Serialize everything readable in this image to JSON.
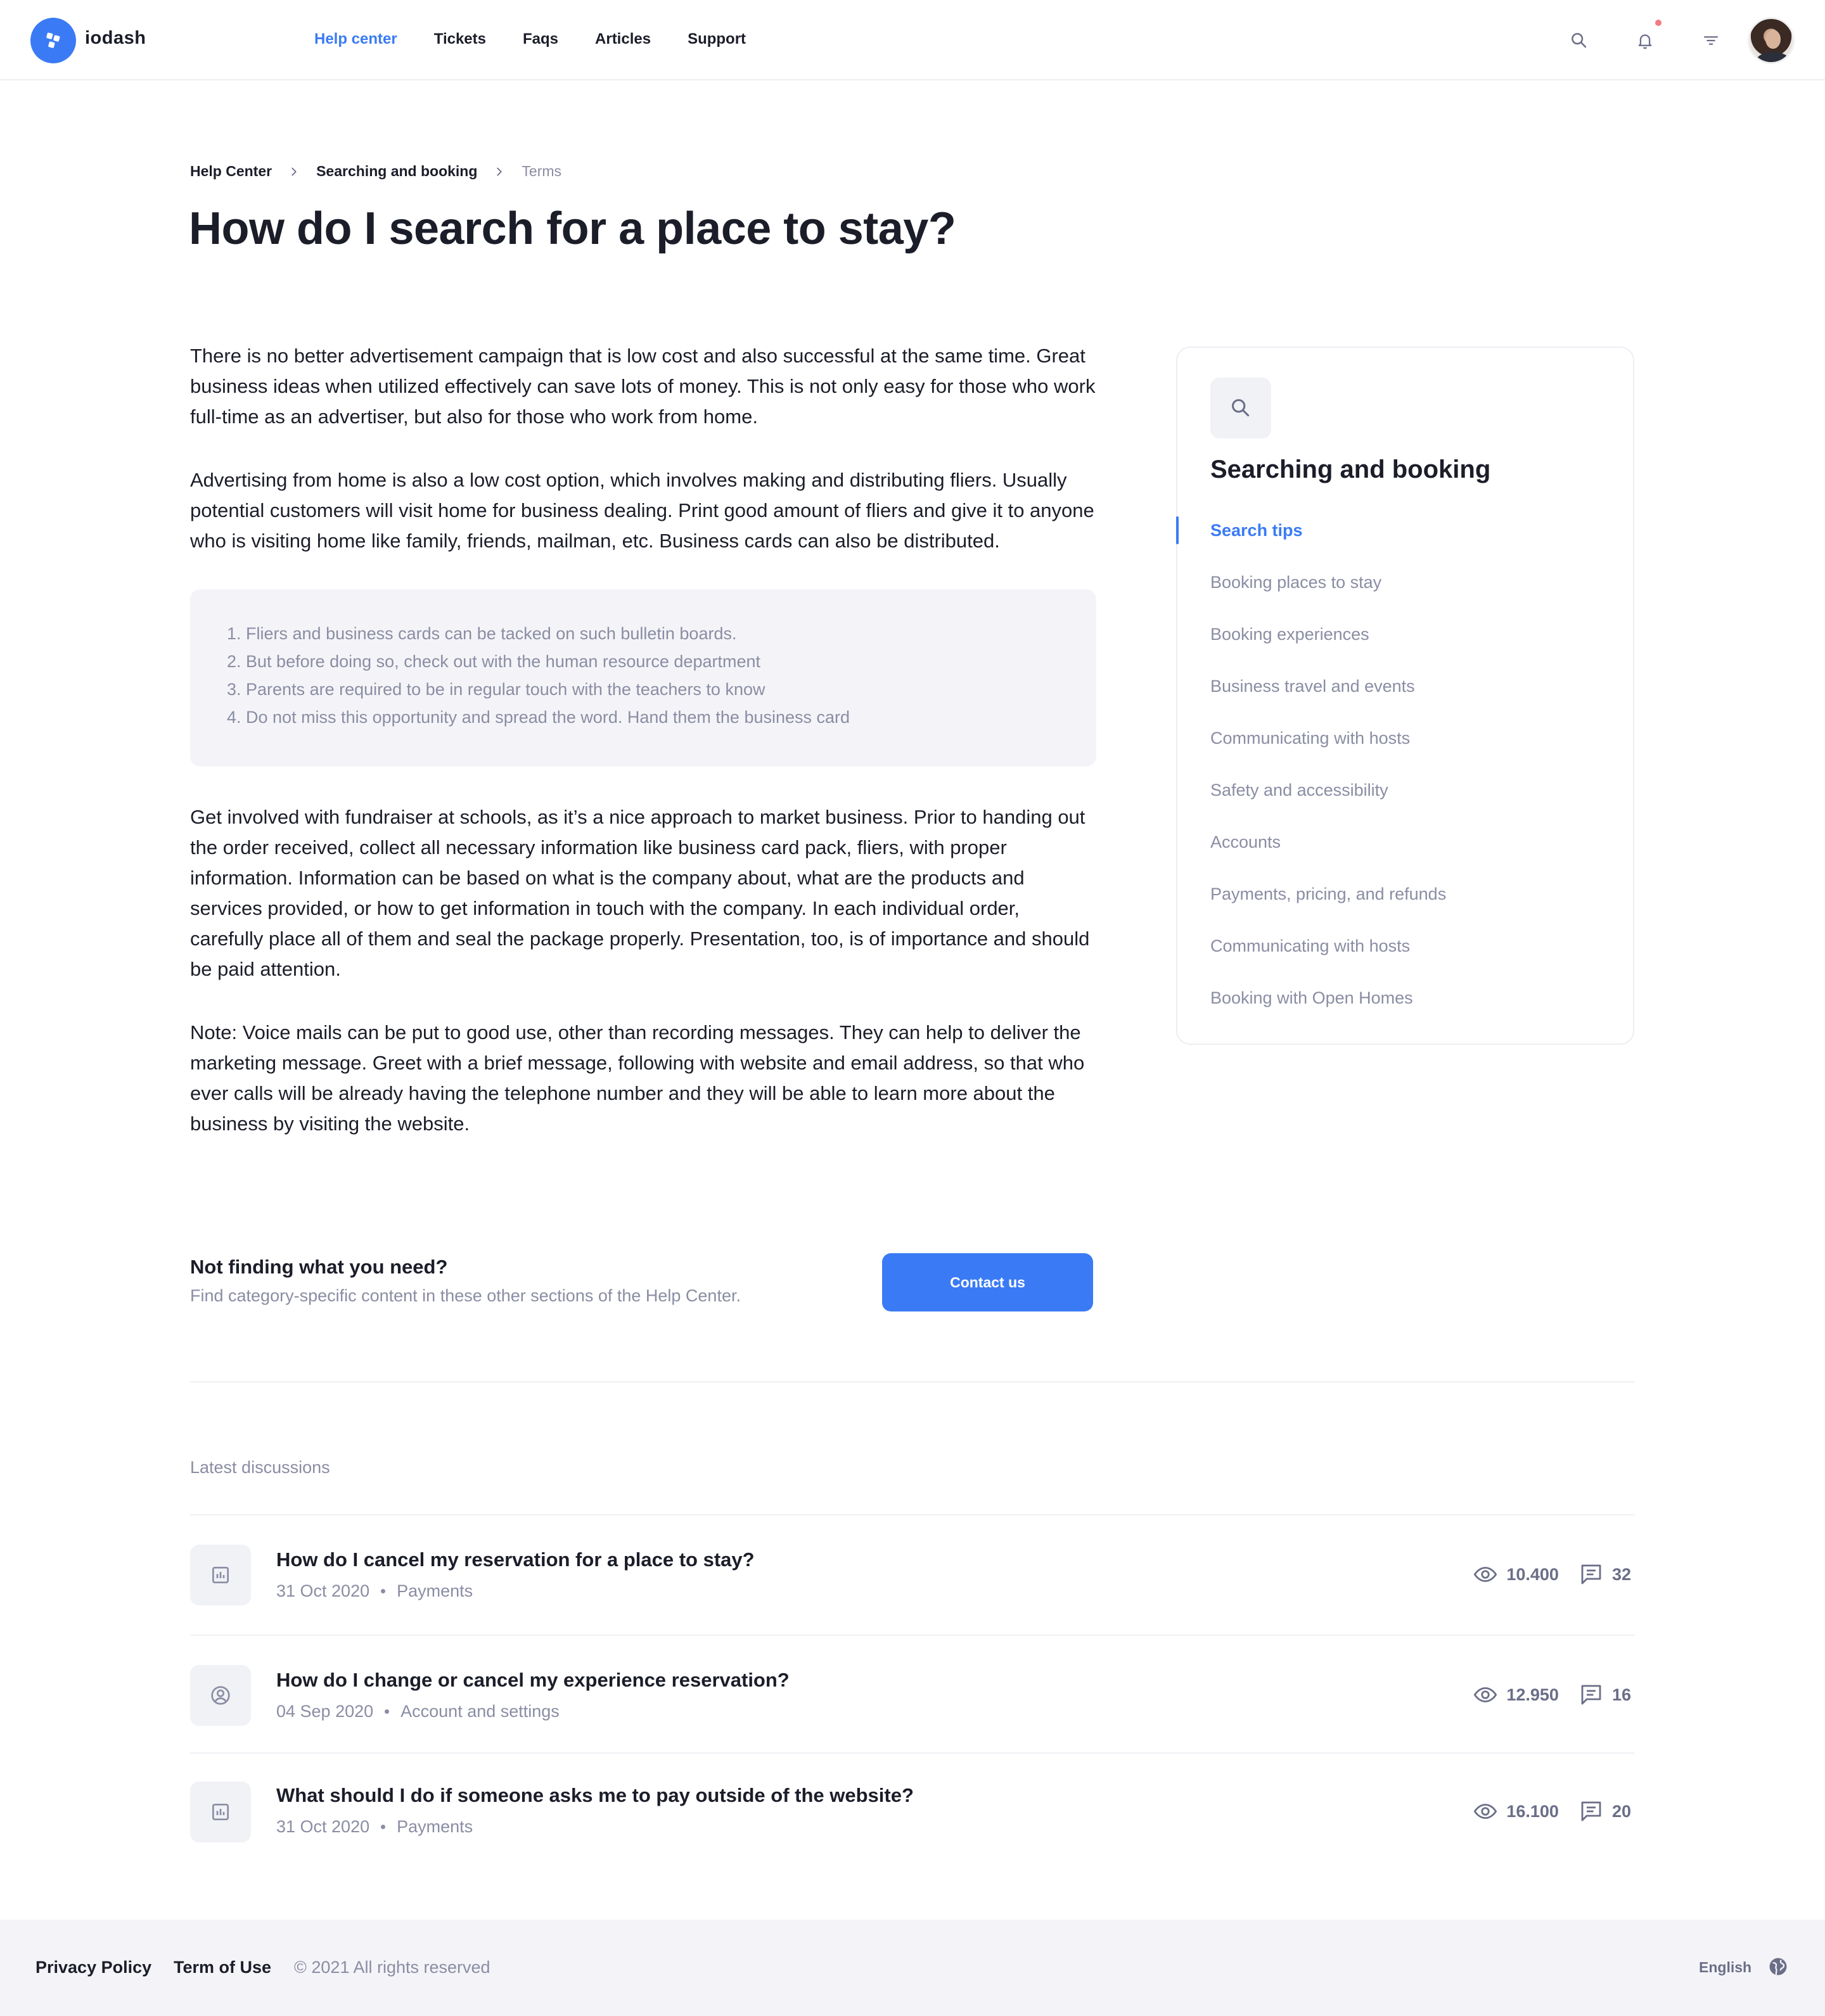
{
  "header": {
    "brand": "iodash",
    "nav": [
      "Help center",
      "Tickets",
      "Faqs",
      "Articles",
      "Support"
    ],
    "active_nav": "Help center",
    "accent_color": "#3a7bf5",
    "notification_dot_color": "#f47a84"
  },
  "breadcrumb": {
    "items": [
      "Help Center",
      "Searching and booking"
    ],
    "current": "Terms"
  },
  "page_title": "How do I search for a place to stay?",
  "article": {
    "paragraphs_top": [
      "There is no better advertisement campaign that is low cost and also successful at the same time. Great business ideas when utilized effectively can save lots of money. This is not only easy for those who work full-time as an advertiser, but also for those who work from home.",
      "Advertising from home is also a low cost option, which involves making and distributing fliers. Usually potential customers will visit home for business dealing. Print good amount of fliers and give it to anyone who is visiting home like family, friends, mailman, etc. Business cards can also be distributed."
    ],
    "list": [
      "1. Fliers and business cards can be tacked on such bulletin boards.",
      "2. But before doing so, check out with the human resource department",
      "3. Parents are required to be in regular touch with the teachers to know",
      "4. Do not miss this opportunity and spread the word. Hand them the business card"
    ],
    "paragraphs_bottom": [
      "Get involved with fundraiser at schools, as it’s a nice approach to market business. Prior to handing out the order received, collect all necessary information like business card pack, fliers, with proper information. Information can be based on what is the company about, what are the products and services provided, or how to get information in touch with the company. In each individual order, carefully place all of them and seal the package properly. Presentation, too, is of importance and should be paid attention.",
      "Note: Voice mails can be put to good use, other than recording messages. They can help to deliver the marketing message. Greet with a brief message, following with website and email address, so that who ever calls will be already having the telephone number and they will be able to learn more about the business by visiting the website."
    ]
  },
  "cta": {
    "title": "Not finding what you need?",
    "subtitle": "Find category-specific content in these other sections of the Help Center.",
    "button": "Contact us"
  },
  "sidebar": {
    "title": "Searching and booking",
    "icon": "search-icon",
    "items": [
      "Search tips",
      "Booking places to stay",
      "Booking experiences",
      "Business travel and events",
      "Communicating with hosts",
      "Safety and accessibility",
      "Accounts",
      "Payments, pricing, and refunds",
      "Communicating with hosts",
      "Booking with Open Homes"
    ],
    "active_item": "Search tips"
  },
  "discussions": {
    "label": "Latest discussions",
    "items": [
      {
        "icon": "chart-icon",
        "title": "How do I cancel my reservation for a place to stay?",
        "date": "31 Oct 2020",
        "category": "Payments",
        "views": "10.400",
        "comments": "32"
      },
      {
        "icon": "user-circle-icon",
        "title": "How do I change or cancel my experience reservation?",
        "date": "04 Sep 2020",
        "category": "Account and settings",
        "views": "12.950",
        "comments": "16"
      },
      {
        "icon": "chart-icon",
        "title": "What should I do if someone asks me to pay outside of the website?",
        "date": "31 Oct 2020",
        "category": "Payments",
        "views": "16.100",
        "comments": "20"
      }
    ]
  },
  "footer": {
    "privacy": "Privacy Policy",
    "terms": "Term of Use",
    "copyright": "© 2021 All rights reserved",
    "language": "English"
  }
}
